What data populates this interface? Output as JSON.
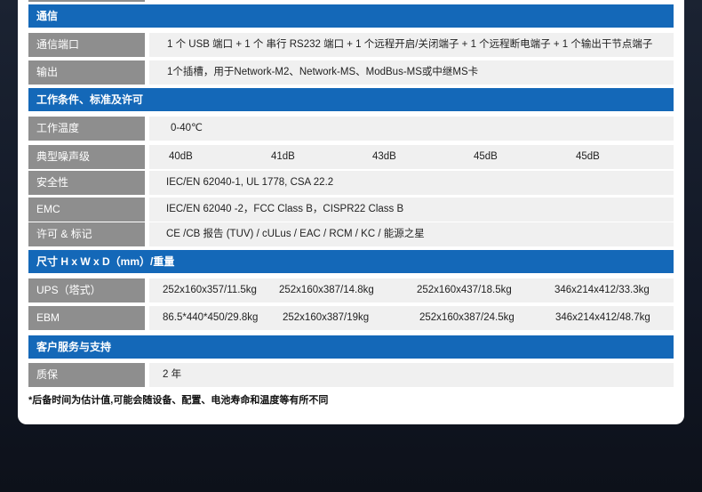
{
  "sections": {
    "comm": "通信",
    "env": "工作条件、标准及许可",
    "dim": "尺寸 H x W x D（mm）/重量",
    "service": "客户服务与支持"
  },
  "rows": {
    "comm_port": {
      "label": "通信端口",
      "value": "1 个 USB 端口 + 1 个 串行 RS232 端口 + 1 个远程开启/关闭端子 + 1 个远程断电端子 + 1 个输出干节点端子"
    },
    "output": {
      "label": "输出",
      "value": "1个插槽，用于Network-M2、Network-MS、ModBus-MS或中继MS卡"
    },
    "temp": {
      "label": "工作温度",
      "value": "0-40℃"
    },
    "noise": {
      "label": "典型噪声级",
      "values": [
        "40dB",
        "41dB",
        "43dB",
        "45dB",
        "45dB"
      ]
    },
    "safety": {
      "label": "安全性",
      "value": "IEC/EN 62040-1, UL 1778, CSA 22.2"
    },
    "emc": {
      "label": "EMC",
      "value": "IEC/EN 62040 -2，FCC Class B，CISPR22 Class B"
    },
    "cert": {
      "label": "许可 & 标记",
      "value": "CE /CB 报告 (TUV) / cULus / EAC / RCM / KC / 能源之星"
    },
    "ups": {
      "label": "UPS（塔式）",
      "values": [
        "252x160x357/11.5kg",
        "252x160x387/14.8kg",
        "252x160x437/18.5kg",
        "346x214x412/33.3kg"
      ]
    },
    "ebm": {
      "label": "EBM",
      "values": [
        "86.5*440*450/29.8kg",
        "252x160x387/19kg",
        "252x160x387/24.5kg",
        "346x214x412/48.7kg"
      ]
    },
    "warranty": {
      "label": "质保",
      "value": "2 年"
    }
  },
  "footnote": "*后备时间为估计值,可能会随设备、配置、电池寿命和温度等有所不同"
}
